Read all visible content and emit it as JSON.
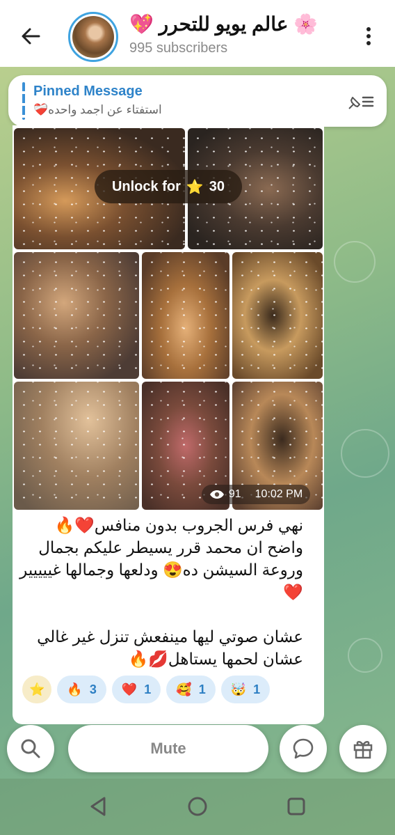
{
  "header": {
    "title": "عالم يويو للتحرر 🌸",
    "title_emoji": "💖",
    "subscribers": "995 subscribers"
  },
  "pinned": {
    "title": "Pinned Message",
    "text": "استفتاء عن اجمد واحده❤️‍🩹"
  },
  "media": {
    "unlock_label": "Unlock for",
    "unlock_price": "30",
    "views": "91",
    "time": "10:02 PM"
  },
  "caption": {
    "line1": "نهي فرس الجروب بدون منافس❤️🔥",
    "line2": "واضح ان محمد قرر يسيطر عليكم بجمال",
    "line3": "وروعة السيشن ده😍 ودلعها وجمالها غييييير",
    "line4": "❤️",
    "line5": "عشان صوتي ليها مينفعش تنزل غير غالي",
    "line6": "عشان لحمها يستاهل💋🔥"
  },
  "reactions": [
    {
      "emoji": "⭐",
      "count": ""
    },
    {
      "emoji": "🔥",
      "count": "3"
    },
    {
      "emoji": "❤️",
      "count": "1"
    },
    {
      "emoji": "🥰",
      "count": "1"
    },
    {
      "emoji": "🤯",
      "count": "1"
    }
  ],
  "bottom": {
    "mute_label": "Mute"
  },
  "colors": {
    "accent": "#2e83c9",
    "reaction_bg": "#dcecfa"
  }
}
